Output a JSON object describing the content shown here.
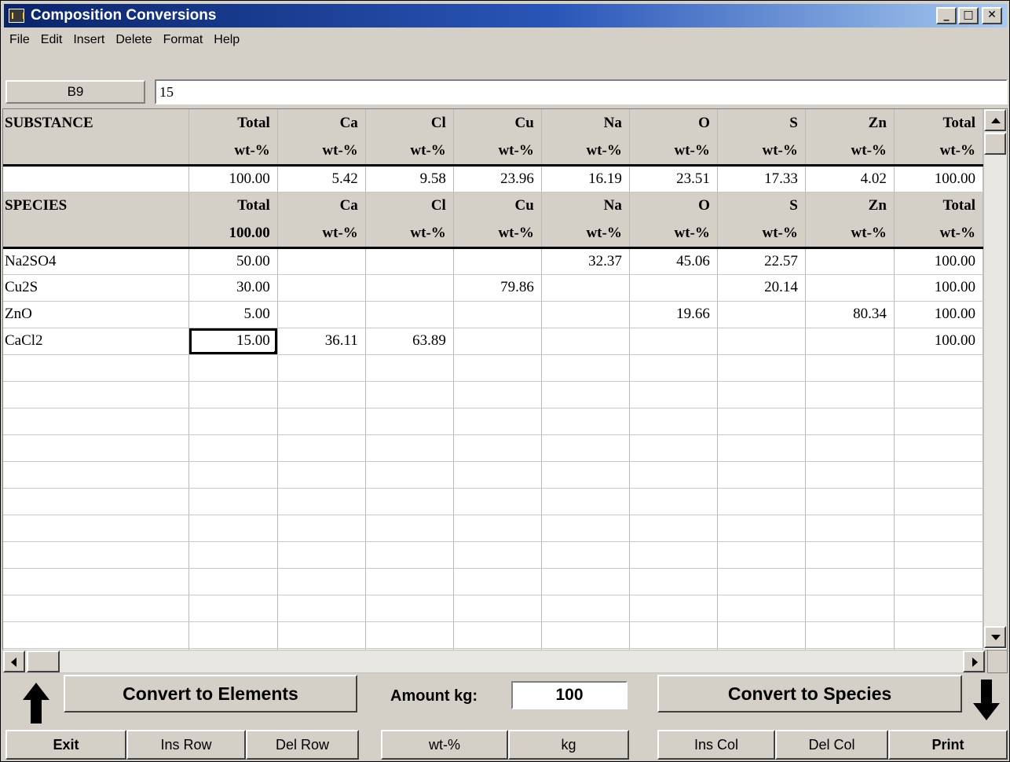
{
  "window": {
    "title": "Composition Conversions"
  },
  "menu": [
    "File",
    "Edit",
    "Insert",
    "Delete",
    "Format",
    "Help"
  ],
  "formula_bar": {
    "cell_ref": "B9",
    "value": "15"
  },
  "substance_header": {
    "row1": [
      "SUBSTANCE",
      "Total",
      "Ca",
      "Cl",
      "Cu",
      "Na",
      "O",
      "S",
      "Zn",
      "Total"
    ],
    "row2": [
      "",
      "wt-%",
      "wt-%",
      "wt-%",
      "wt-%",
      "wt-%",
      "wt-%",
      "wt-%",
      "wt-%",
      "wt-%"
    ]
  },
  "substance_values": [
    "",
    "100.00",
    "5.42",
    "9.58",
    "23.96",
    "16.19",
    "23.51",
    "17.33",
    "4.02",
    "100.00"
  ],
  "species_header": {
    "row1": [
      "SPECIES",
      "Total",
      "Ca",
      "Cl",
      "Cu",
      "Na",
      "O",
      "S",
      "Zn",
      "Total"
    ],
    "row2": [
      "",
      "100.00",
      "wt-%",
      "wt-%",
      "wt-%",
      "wt-%",
      "wt-%",
      "wt-%",
      "wt-%",
      "wt-%"
    ]
  },
  "species_rows": [
    [
      "Na2SO4",
      "50.00",
      "",
      "",
      "",
      "32.37",
      "45.06",
      "22.57",
      "",
      "100.00"
    ],
    [
      "Cu2S",
      "30.00",
      "",
      "",
      "79.86",
      "",
      "",
      "20.14",
      "",
      "100.00"
    ],
    [
      "ZnO",
      "5.00",
      "",
      "",
      "",
      "",
      "19.66",
      "",
      "80.34",
      "100.00"
    ],
    [
      "CaCl2",
      "15.00",
      "36.11",
      "63.89",
      "",
      "",
      "",
      "",
      "",
      "100.00"
    ]
  ],
  "empty_rows": 12,
  "buttons": {
    "convert_elements": "Convert to Elements",
    "convert_species": "Convert to Species",
    "amount_label": "Amount kg:",
    "amount_value": "100",
    "exit": "Exit",
    "ins_row": "Ins Row",
    "del_row": "Del Row",
    "wt_pct": "wt-%",
    "kg": "kg",
    "ins_col": "Ins Col",
    "del_col": "Del Col",
    "print": "Print"
  },
  "window_controls": {
    "minimize": "_",
    "maximize": "□",
    "close": "✕"
  },
  "icons": [
    "app-icon",
    "up-arrow-icon",
    "down-arrow-icon",
    "scroll-up-icon",
    "scroll-down-icon",
    "scroll-left-icon",
    "scroll-right-icon"
  ]
}
